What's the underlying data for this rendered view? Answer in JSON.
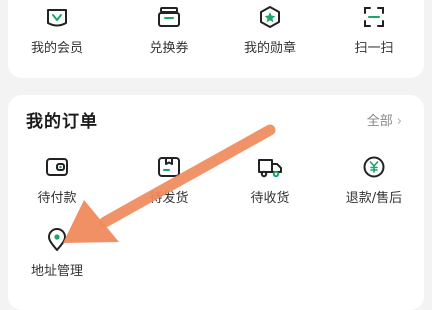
{
  "top_row": [
    {
      "label": "我的会员",
      "icon": "crown-icon"
    },
    {
      "label": "兑换券",
      "icon": "gift-box-icon"
    },
    {
      "label": "我的勋章",
      "icon": "medal-icon"
    },
    {
      "label": "扫一扫",
      "icon": "scan-icon"
    }
  ],
  "orders": {
    "title": "我的订单",
    "view_all": "全部",
    "items": [
      {
        "label": "待付款",
        "icon": "wallet-icon"
      },
      {
        "label": "待发货",
        "icon": "package-icon"
      },
      {
        "label": "待收货",
        "icon": "truck-icon"
      },
      {
        "label": "退款/售后",
        "icon": "refund-yen-icon"
      },
      {
        "label": "地址管理",
        "icon": "location-pin-icon"
      }
    ]
  },
  "colors": {
    "accent_green": "#1fa46a",
    "arrow": "#f08a5d"
  }
}
